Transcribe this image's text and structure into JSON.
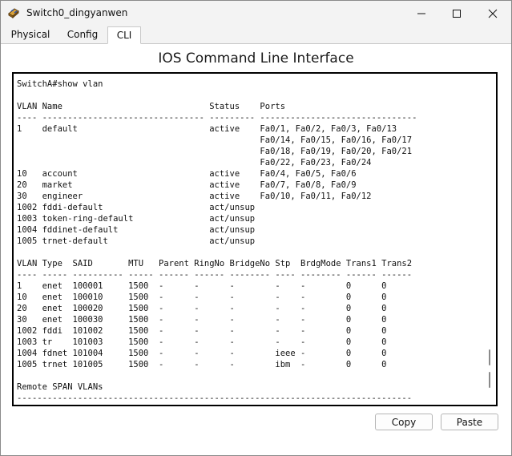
{
  "window": {
    "title": "Switch0_dingyanwen"
  },
  "tabs": [
    "Physical",
    "Config",
    "CLI"
  ],
  "active_tab": "CLI",
  "heading": "IOS Command Line Interface",
  "cli_lines": [
    "SwitchA#show vlan",
    "",
    "VLAN Name                             Status    Ports",
    "---- -------------------------------- --------- -------------------------------",
    "1    default                          active    Fa0/1, Fa0/2, Fa0/3, Fa0/13",
    "                                                Fa0/14, Fa0/15, Fa0/16, Fa0/17",
    "                                                Fa0/18, Fa0/19, Fa0/20, Fa0/21",
    "                                                Fa0/22, Fa0/23, Fa0/24",
    "10   account                          active    Fa0/4, Fa0/5, Fa0/6",
    "20   market                           active    Fa0/7, Fa0/8, Fa0/9",
    "30   engineer                         active    Fa0/10, Fa0/11, Fa0/12",
    "1002 fddi-default                     act/unsup",
    "1003 token-ring-default               act/unsup",
    "1004 fddinet-default                  act/unsup",
    "1005 trnet-default                    act/unsup",
    "",
    "VLAN Type  SAID       MTU   Parent RingNo BridgeNo Stp  BrdgMode Trans1 Trans2",
    "---- ----- ---------- ----- ------ ------ -------- ---- -------- ------ ------",
    "1    enet  100001     1500  -      -      -        -    -        0      0",
    "10   enet  100010     1500  -      -      -        -    -        0      0",
    "20   enet  100020     1500  -      -      -        -    -        0      0",
    "30   enet  100030     1500  -      -      -        -    -        0      0",
    "1002 fddi  101002     1500  -      -      -        -    -        0      0",
    "1003 tr    101003     1500  -      -      -        -    -        0      0",
    "1004 fdnet 101004     1500  -      -      -        ieee -        0      0",
    "1005 trnet 101005     1500  -      -      -        ibm  -        0      0",
    "",
    "Remote SPAN VLANs",
    "------------------------------------------------------------------------------"
  ],
  "buttons": {
    "copy": "Copy",
    "paste": "Paste"
  },
  "icons": {
    "app": "packet-tracer-switch-icon",
    "minimize": "minimize-icon",
    "maximize": "maximize-icon",
    "close": "close-icon"
  }
}
